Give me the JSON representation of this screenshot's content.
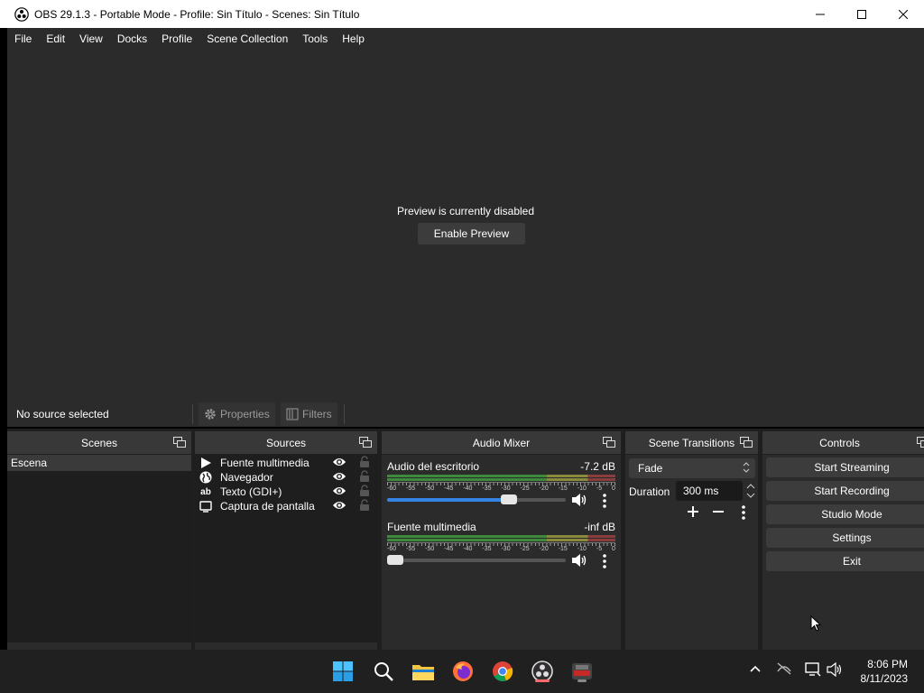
{
  "window": {
    "title": "OBS 29.1.3 - Portable Mode - Profile: Sin Título - Scenes: Sin Título",
    "app_icon": "obs-logo-icon"
  },
  "menu": [
    "File",
    "Edit",
    "View",
    "Docks",
    "Profile",
    "Scene Collection",
    "Tools",
    "Help"
  ],
  "preview": {
    "message": "Preview is currently disabled",
    "enable_button": "Enable Preview"
  },
  "context_bar": {
    "status": "No source selected",
    "properties": "Properties",
    "filters": "Filters"
  },
  "docks": {
    "scenes": {
      "title": "Scenes",
      "items": [
        "Escena"
      ]
    },
    "sources": {
      "title": "Sources",
      "items": [
        {
          "label": "Fuente multimedia",
          "icon": "play-icon"
        },
        {
          "label": "Navegador",
          "icon": "globe-icon"
        },
        {
          "label": "Texto (GDI+)",
          "icon": "text-icon"
        },
        {
          "label": "Captura de pantalla",
          "icon": "monitor-icon"
        }
      ]
    },
    "audio_mixer": {
      "title": "Audio Mixer",
      "scale": [
        "-60",
        "-55",
        "-50",
        "-45",
        "-40",
        "-35",
        "-30",
        "-25",
        "-20",
        "-15",
        "-10",
        "-5",
        "0"
      ],
      "tracks": [
        {
          "name": "Audio del escritorio",
          "level": "-7.2 dB",
          "volume_fraction": 0.7
        },
        {
          "name": "Fuente multimedia",
          "level": "-inf dB",
          "volume_fraction": 0.0
        }
      ]
    },
    "scene_transitions": {
      "title": "Scene Transitions",
      "selected": "Fade",
      "duration_label": "Duration",
      "duration_value": "300 ms"
    },
    "controls": {
      "title": "Controls",
      "buttons": [
        "Start Streaming",
        "Start Recording",
        "Studio Mode",
        "Settings",
        "Exit"
      ]
    }
  },
  "taskbar": {
    "apps": [
      "start-icon",
      "search-icon",
      "file-explorer-icon",
      "firefox-icon",
      "chrome-icon",
      "obs-icon",
      "game-app-icon"
    ],
    "time": "8:06 PM",
    "date": "8/11/2023"
  },
  "colors": {
    "panel": "#2b2b2b",
    "dock_title": "#383838",
    "accent": "#3584e4"
  }
}
